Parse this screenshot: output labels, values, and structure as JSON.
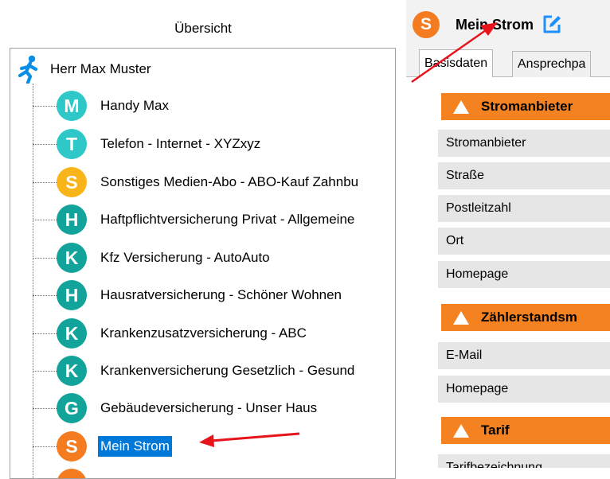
{
  "left": {
    "title": "Übersicht",
    "root": {
      "label": "Herr Max Muster",
      "icon": "person-icon"
    },
    "items": [
      {
        "letter": "M",
        "color": "#2ec8c8",
        "label": "Handy Max"
      },
      {
        "letter": "T",
        "color": "#2ec8c8",
        "label": "Telefon - Internet - XYZxyz"
      },
      {
        "letter": "S",
        "color": "#f7b519",
        "label": "Sonstiges Medien-Abo - ABO-Kauf Zahnbu"
      },
      {
        "letter": "H",
        "color": "#12a39b",
        "label": "Haftpflichtversicherung Privat - Allgemeine"
      },
      {
        "letter": "K",
        "color": "#12a39b",
        "label": "Kfz Versicherung - AutoAuto"
      },
      {
        "letter": "H",
        "color": "#12a39b",
        "label": "Hausratversicherung - Schöner Wohnen"
      },
      {
        "letter": "K",
        "color": "#12a39b",
        "label": "Krankenzusatzversicherung - ABC"
      },
      {
        "letter": "K",
        "color": "#12a39b",
        "label": "Krankenversicherung Gesetzlich - Gesund"
      },
      {
        "letter": "G",
        "color": "#12a39b",
        "label": "Gebäudeversicherung - Unser Haus"
      },
      {
        "letter": "S",
        "color": "#f47b20",
        "label": "Mein Strom",
        "selected": true
      },
      {
        "letter": "",
        "color": "#f47b20",
        "label": ""
      }
    ]
  },
  "right": {
    "header": {
      "letter": "S",
      "title": "Mein Strom",
      "edit_icon": "edit-icon"
    },
    "tabs": [
      "Basisdaten",
      "Ansprechpa"
    ],
    "sections": [
      {
        "title": "Stromanbieter",
        "fields": [
          "Stromanbieter",
          "Straße",
          "Postleitzahl",
          "Ort",
          "Homepage"
        ]
      },
      {
        "title": "Zählerstandsm",
        "fields": [
          "E-Mail",
          "Homepage"
        ]
      },
      {
        "title": "Tarif",
        "fields": [
          "Tarifbezeichnung"
        ]
      }
    ]
  },
  "colors": {
    "accent_orange": "#f58220",
    "selection_blue": "#0078d7",
    "annotation_red": "#e8141c"
  }
}
